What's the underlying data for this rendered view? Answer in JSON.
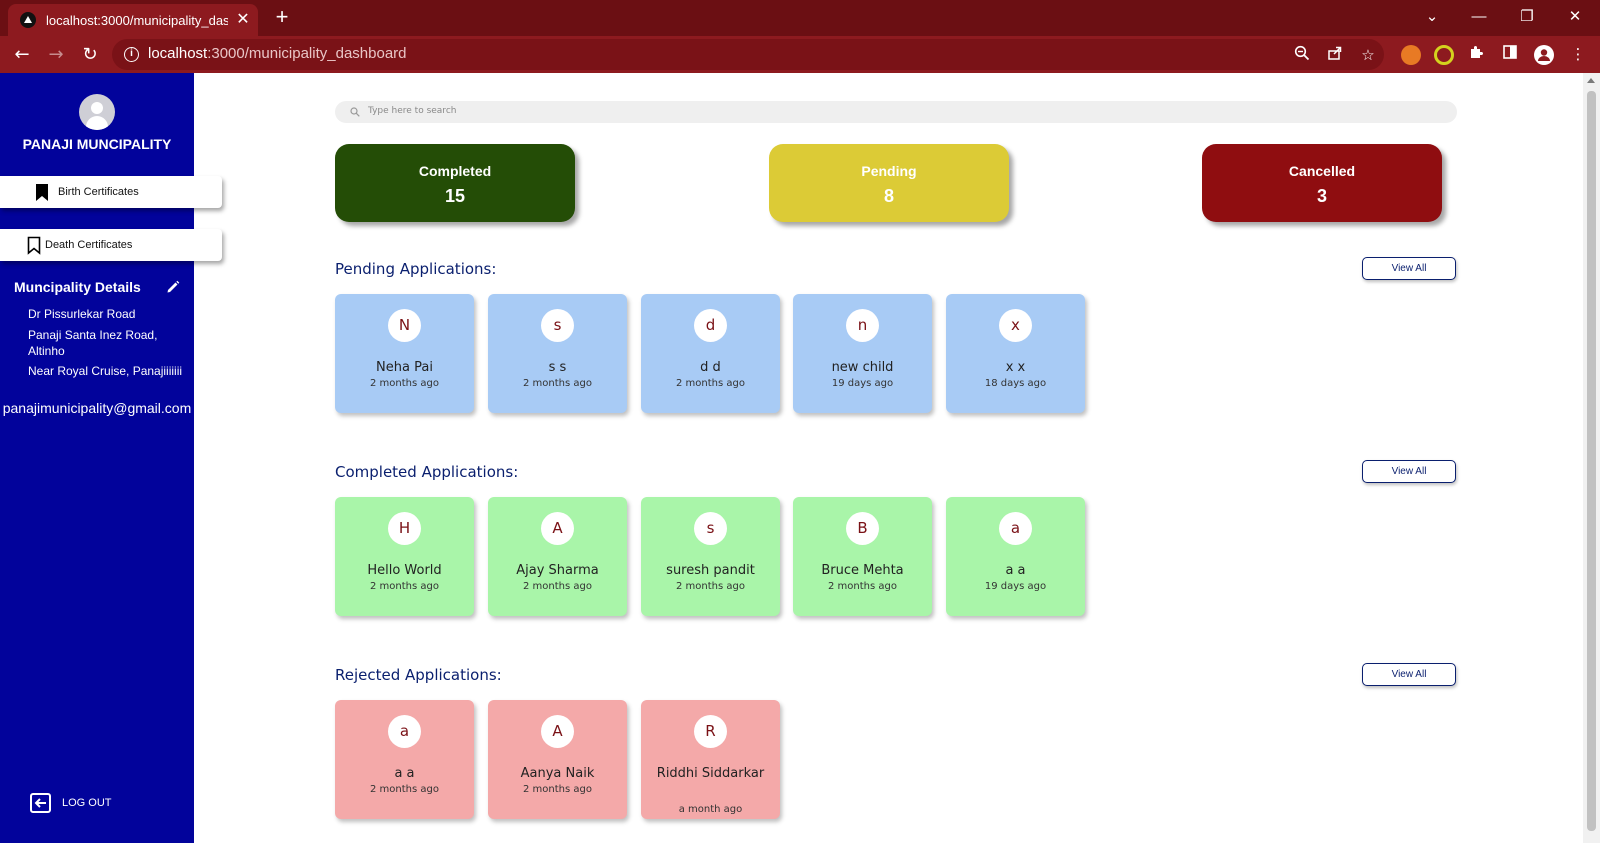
{
  "browser": {
    "tab_title": "localhost:3000/municipality_dashboard",
    "url_host": "localhost",
    "url_path": ":3000/municipality_dashboard",
    "icons": [
      "back-icon",
      "forward-icon",
      "reload-icon",
      "info-icon",
      "zoom-icon",
      "share-icon",
      "star-icon",
      "extensions-icon",
      "sidepanel-icon",
      "profile-icon",
      "menu-icon"
    ]
  },
  "sidebar": {
    "title": "PANAJI MUNCIPALITY",
    "items": [
      {
        "label": "Birth Certificates"
      },
      {
        "label": "Death Certificates"
      }
    ],
    "details_title": "Muncipality Details",
    "address_lines": [
      "Dr Pissurlekar Road",
      "Panaji Santa Inez Road, Altinho",
      "Near Royal Cruise, Panajiiiiiii"
    ],
    "email": "panajimunicipality@gmail.com",
    "logout_label": "LOG OUT"
  },
  "search": {
    "placeholder": "Type here to search"
  },
  "stats": [
    {
      "title": "Completed",
      "value": "15",
      "color": "#244d06"
    },
    {
      "title": "Pending",
      "value": "8",
      "color": "#dccb36"
    },
    {
      "title": "Cancelled",
      "value": "3",
      "color": "#8f0d10"
    }
  ],
  "sections": {
    "pending": {
      "title": "Pending Applications:",
      "view_all": "View All",
      "items": [
        {
          "initial": "N",
          "name": "Neha Pai",
          "time": "2 months ago"
        },
        {
          "initial": "s",
          "name": "s s",
          "time": "2 months ago"
        },
        {
          "initial": "d",
          "name": "d d",
          "time": "2 months ago"
        },
        {
          "initial": "n",
          "name": "new child",
          "time": "19 days ago"
        },
        {
          "initial": "x",
          "name": "x x",
          "time": "18 days ago"
        }
      ]
    },
    "completed": {
      "title": "Completed Applications:",
      "view_all": "View All",
      "items": [
        {
          "initial": "H",
          "name": "Hello World",
          "time": "2 months ago"
        },
        {
          "initial": "A",
          "name": "Ajay Sharma",
          "time": "2 months ago"
        },
        {
          "initial": "s",
          "name": "suresh pandit",
          "time": "2 months ago"
        },
        {
          "initial": "B",
          "name": "Bruce Mehta",
          "time": "2 months ago"
        },
        {
          "initial": "a",
          "name": "a a",
          "time": "19 days ago"
        }
      ]
    },
    "rejected": {
      "title": "Rejected Applications:",
      "view_all": "View All",
      "items": [
        {
          "initial": "a",
          "name": "a a",
          "time": "2 months ago"
        },
        {
          "initial": "A",
          "name": "Aanya Naik",
          "time": "2 months ago"
        },
        {
          "initial": "R",
          "name": "Riddhi Siddarkar",
          "time": "a month ago"
        }
      ]
    }
  }
}
